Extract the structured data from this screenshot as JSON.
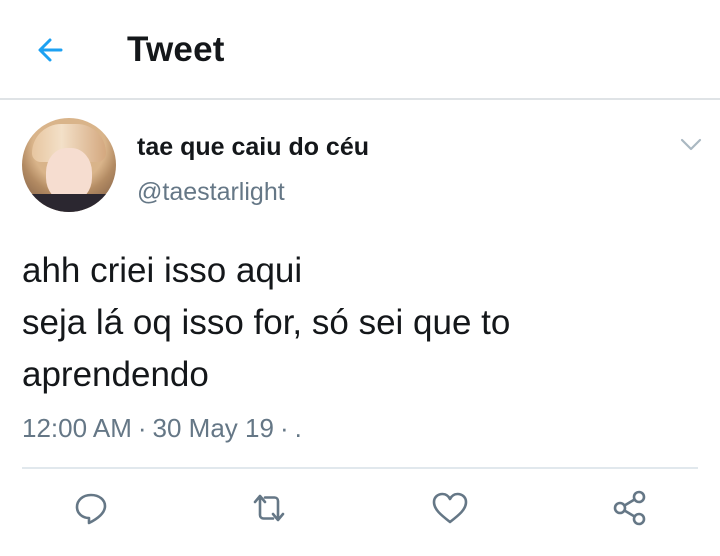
{
  "header": {
    "back_icon": "arrow-left-icon",
    "title": "Tweet",
    "accent_color": "#1da1f2"
  },
  "tweet": {
    "avatar_alt": "",
    "display_name": "tae que caiu do céu",
    "handle": "@taestarlight",
    "caret_icon": "chevron-down-icon",
    "text_lines": [
      "ahh criei isso aqui",
      "seja lá oq isso for, só sei que to",
      "aprendendo"
    ],
    "time": "12:00 AM",
    "date": "30 May 19",
    "source": "."
  },
  "actions": [
    {
      "name": "reply",
      "icon": "reply-icon"
    },
    {
      "name": "retweet",
      "icon": "retweet-icon"
    },
    {
      "name": "like",
      "icon": "heart-icon"
    },
    {
      "name": "share",
      "icon": "share-icon"
    }
  ],
  "colors": {
    "text": "#14171a",
    "secondary": "#657786",
    "divider": "#e1e8ed"
  }
}
